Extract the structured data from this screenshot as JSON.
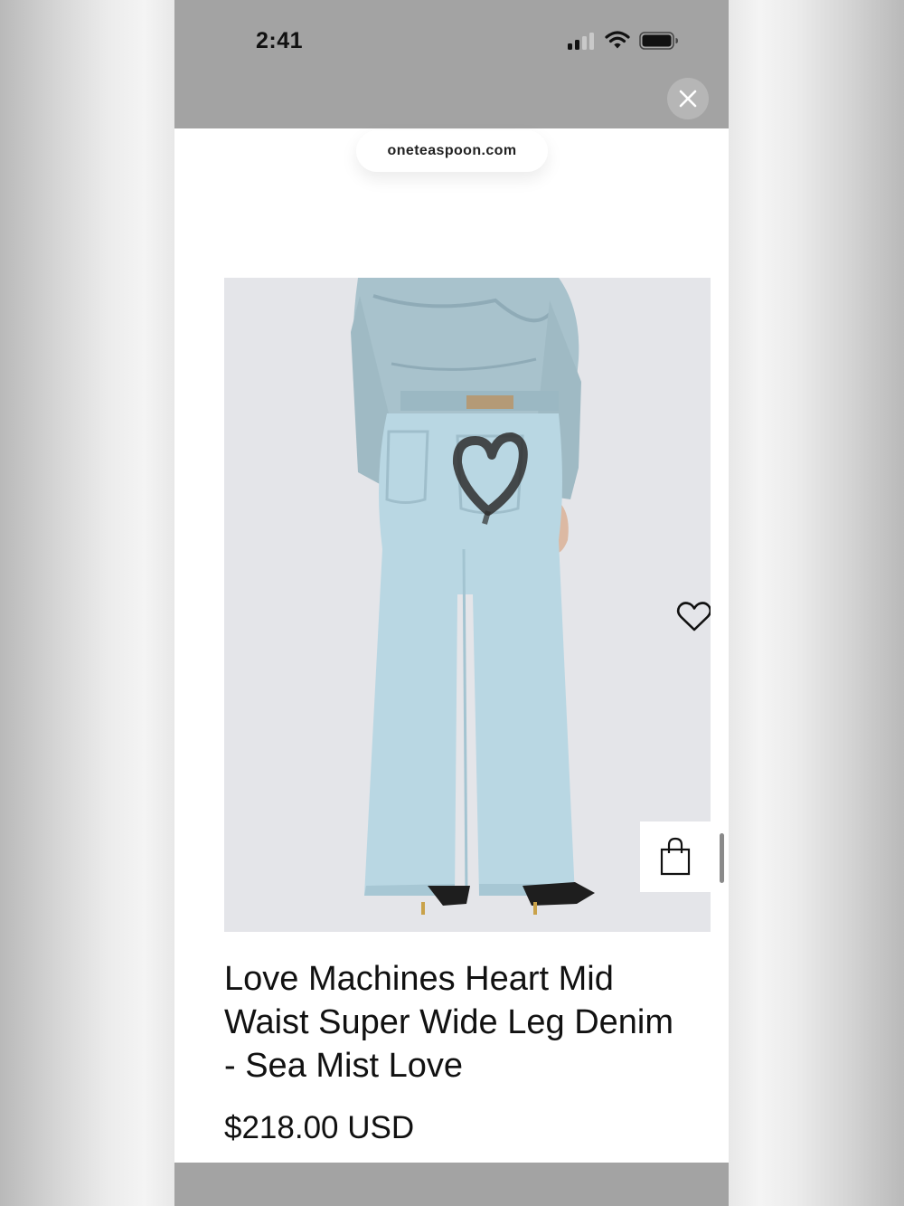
{
  "status_bar": {
    "time": "2:41"
  },
  "browser": {
    "url": "oneteaspoon.com"
  },
  "product": {
    "title": "Love Machines Heart Mid Waist Super Wide Leg Denim - Sea Mist Love",
    "price": "$218.00 USD"
  },
  "icons": {
    "signal": "cellular-signal-icon",
    "wifi": "wifi-icon",
    "battery": "battery-icon",
    "close": "close-icon",
    "wishlist": "heart-icon",
    "bag": "shopping-bag-icon"
  },
  "colors": {
    "overlay_gray": "#a3a3a3",
    "denim": "#b9d7e3",
    "background": "#e4e5e9"
  }
}
